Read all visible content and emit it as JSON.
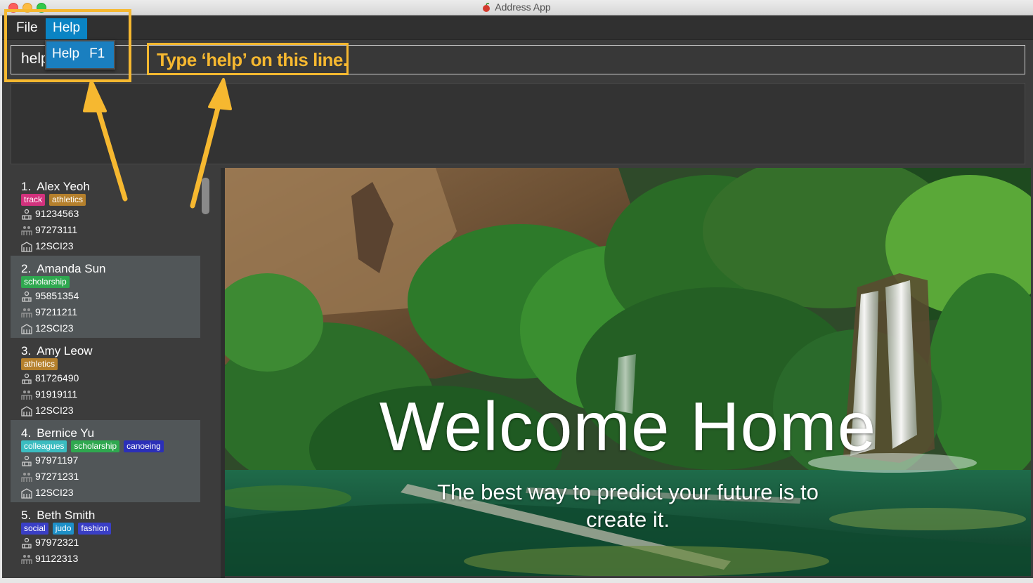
{
  "window": {
    "title": "Address App"
  },
  "menu": {
    "file": "File",
    "help": "Help"
  },
  "dropdown": {
    "item_label": "Help",
    "item_shortcut": "F1"
  },
  "command": {
    "value": "help"
  },
  "annotation": {
    "text": "Type ‘help’ on this line.",
    "color": "#f6b830"
  },
  "persons": [
    {
      "index": "1.",
      "name": "Alex Yeoh",
      "tags": [
        {
          "label": "track",
          "color": "#d2327d"
        },
        {
          "label": "athletics",
          "color": "#b5802c"
        }
      ],
      "phone": "91234563",
      "parent_phone": "97273111",
      "class": "12SCI23"
    },
    {
      "index": "2.",
      "name": "Amanda Sun",
      "tags": [
        {
          "label": "scholarship",
          "color": "#2fa84f"
        }
      ],
      "phone": "95851354",
      "parent_phone": "97211211",
      "class": "12SCI23"
    },
    {
      "index": "3.",
      "name": "Amy Leow",
      "tags": [
        {
          "label": "athletics",
          "color": "#b5802c"
        }
      ],
      "phone": "81726490",
      "parent_phone": "91919111",
      "class": "12SCI23"
    },
    {
      "index": "4.",
      "name": "Bernice Yu",
      "tags": [
        {
          "label": "colleagues",
          "color": "#3bbcc0"
        },
        {
          "label": "scholarship",
          "color": "#2fa84f"
        },
        {
          "label": "canoeing",
          "color": "#2b2fb8"
        }
      ],
      "phone": "97971197",
      "parent_phone": "97271231",
      "class": "12SCI23"
    },
    {
      "index": "5.",
      "name": "Beth Smith",
      "tags": [
        {
          "label": "social",
          "color": "#3a3fc6"
        },
        {
          "label": "judo",
          "color": "#1e90c8"
        },
        {
          "label": "fashion",
          "color": "#3a3fc6"
        }
      ],
      "phone": "97972321",
      "parent_phone": "91122313",
      "class": ""
    }
  ],
  "welcome": {
    "title": "Welcome Home",
    "subtitle_line1": "The best way to predict your future is to",
    "subtitle_line2": "create it."
  }
}
